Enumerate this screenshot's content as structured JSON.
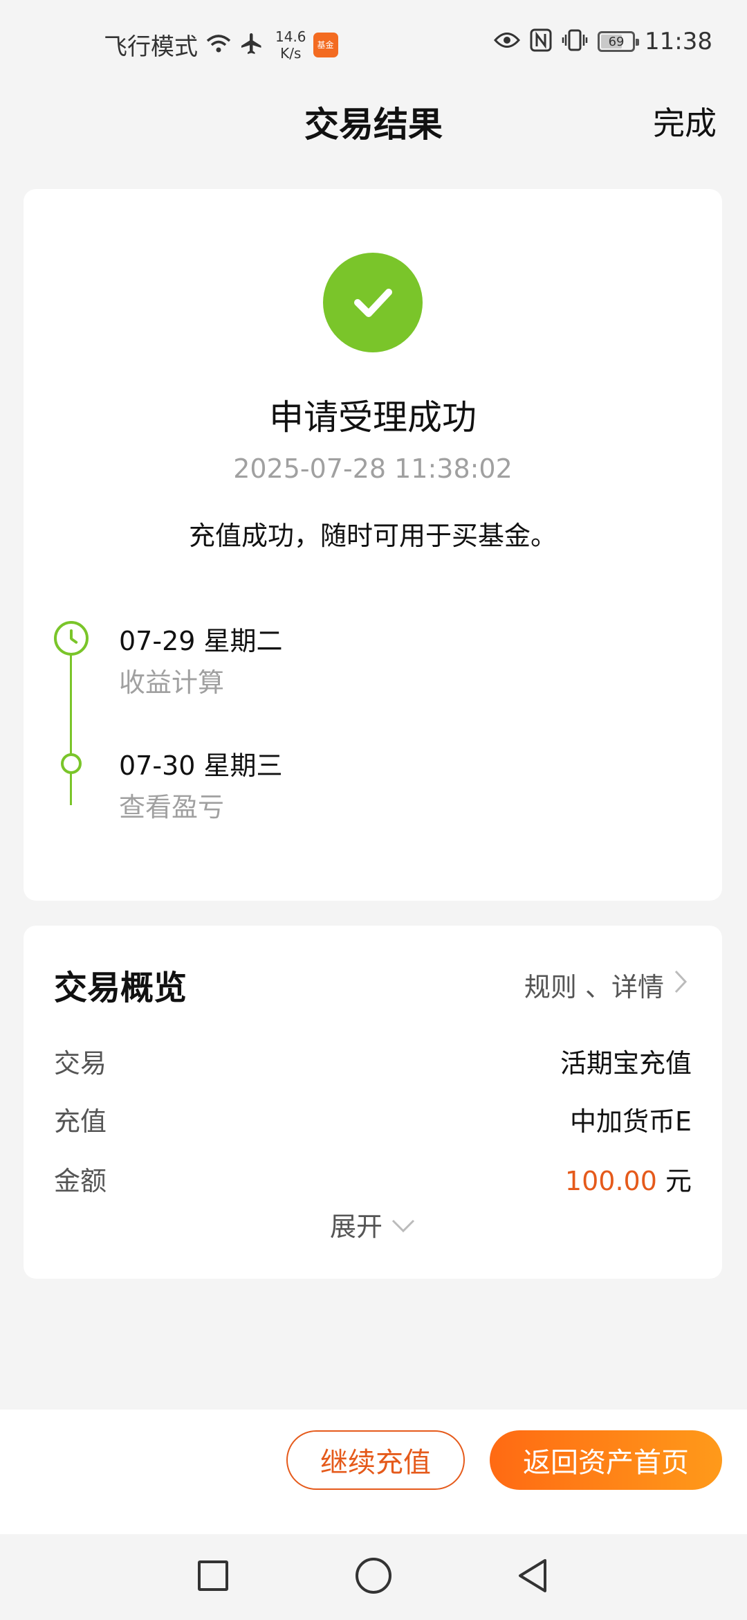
{
  "status_bar": {
    "carrier_text": "飞行模式",
    "net_speed_value": "14.6",
    "net_speed_unit": "K/s",
    "app_badge": "基金",
    "battery_level": "69",
    "time": "11:38"
  },
  "header": {
    "title": "交易结果",
    "done_label": "完成"
  },
  "result": {
    "title": "申请受理成功",
    "timestamp": "2025-07-28 11:38:02",
    "description": "充值成功，随时可用于买基金。",
    "success_color": "#7ac52a",
    "timeline": [
      {
        "date": "07-29  星期二",
        "label": "收益计算"
      },
      {
        "date": "07-30  星期三",
        "label": "查看盈亏"
      }
    ]
  },
  "overview": {
    "title": "交易概览",
    "link_label": "规则 、详情",
    "rows": [
      {
        "label": "交易",
        "value": "活期宝充值"
      },
      {
        "label": "充值",
        "value": "中加货币E"
      },
      {
        "label": "金额",
        "amount": "100.00",
        "unit": "元"
      }
    ],
    "expand_label": "展开"
  },
  "actions": {
    "continue_label": "继续充值",
    "home_label": "返回资产首页",
    "accent_color": "#ff6a13"
  }
}
